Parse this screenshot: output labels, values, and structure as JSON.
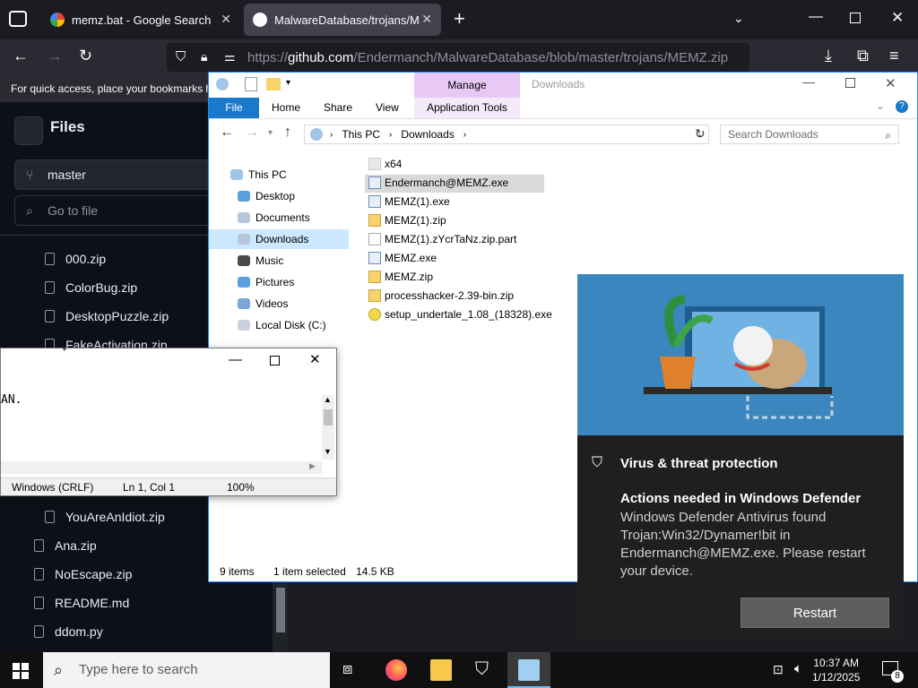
{
  "browser": {
    "tabs": [
      {
        "title": "memz.bat - Google Search",
        "active": false
      },
      {
        "title": "MalwareDatabase/trojans/MEMZ",
        "active": true
      }
    ],
    "new_tab": "+",
    "url_prefix": "https://",
    "url_host": "github.com",
    "url_path": "/Endermanch/MalwareDatabase/blob/master/trojans/MEMZ.zip",
    "bookmarks_hint": "For quick access, place your bookmarks here on the bookmarks toolbar."
  },
  "github": {
    "panel_title": "Files",
    "branch": "master",
    "go_to_file_placeholder": "Go to file",
    "files_top": [
      "000.zip",
      "ColorBug.zip",
      "DesktopPuzzle.zip",
      "FakeActivation.zip"
    ],
    "files_bottom": [
      "YouAreAnIdiot.zip",
      "Ana.zip",
      "NoEscape.zip",
      "README.md",
      "ddom.py"
    ]
  },
  "explorer": {
    "title": "Downloads",
    "manage_label": "Manage",
    "ribbon_tabs": [
      "File",
      "Home",
      "Share",
      "View",
      "Application Tools"
    ],
    "address": [
      "This PC",
      "Downloads"
    ],
    "search_placeholder": "Search Downloads",
    "nav_items": [
      "This PC",
      "Desktop",
      "Documents",
      "Downloads",
      "Music",
      "Pictures",
      "Videos",
      "Local Disk (C:)"
    ],
    "files": [
      {
        "name": "x64",
        "kind": "folder"
      },
      {
        "name": "Endermanch@MEMZ.exe",
        "kind": "exe",
        "selected": true
      },
      {
        "name": "MEMZ(1).exe",
        "kind": "exe"
      },
      {
        "name": "MEMZ(1).zip",
        "kind": "zip"
      },
      {
        "name": "MEMZ(1).zYcrTaNz.zip.part",
        "kind": "part"
      },
      {
        "name": "MEMZ.exe",
        "kind": "exe"
      },
      {
        "name": "MEMZ.zip",
        "kind": "zip"
      },
      {
        "name": "processhacker-2.39-bin.zip",
        "kind": "zip"
      },
      {
        "name": "setup_undertale_1.08_(18328).exe",
        "kind": "setup"
      }
    ],
    "status": {
      "count": "9 items",
      "selected": "1 item selected",
      "size": "14.5 KB"
    }
  },
  "notepad": {
    "content_fragment": "AN.",
    "encoding": "Windows (CRLF)",
    "position": "Ln 1, Col 1",
    "zoom": "100%"
  },
  "toast": {
    "app": "Virus & threat protection",
    "title": "Actions needed in Windows Defender",
    "body": "Windows Defender Antivirus found Trojan:Win32/Dynamer!bit in Endermanch@MEMZ.exe. Please restart your device.",
    "button": "Restart"
  },
  "taskbar": {
    "search_placeholder": "Type here to search",
    "time": "10:37 AM",
    "date": "1/12/2025",
    "notification_count": "8"
  },
  "colors": {
    "accent": "#1979ca",
    "toast_bg": "#1f1f1f",
    "manage": "#e8c9f6"
  }
}
